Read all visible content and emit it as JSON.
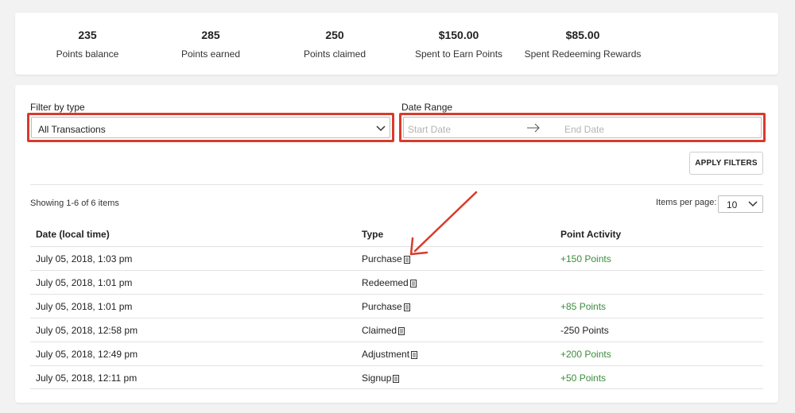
{
  "stats": [
    {
      "value": "235",
      "label": "Points balance"
    },
    {
      "value": "285",
      "label": "Points earned"
    },
    {
      "value": "250",
      "label": "Points claimed"
    },
    {
      "value": "$150.00",
      "label": "Spent to Earn Points"
    },
    {
      "value": "$85.00",
      "label": "Spent Redeeming Rewards"
    }
  ],
  "filters": {
    "type_label": "Filter by type",
    "type_value": "All Transactions",
    "date_label": "Date Range",
    "start_placeholder": "Start Date",
    "end_placeholder": "End Date",
    "apply_label": "APPLY FILTERS"
  },
  "pagination": {
    "showing": "Showing 1-6 of 6 items",
    "items_per_page_label": "Items per page:",
    "items_per_page_value": "10"
  },
  "table": {
    "headers": [
      "Date (local time)",
      "Type",
      "Point Activity"
    ],
    "rows": [
      {
        "date": "July 05, 2018, 1:03 pm",
        "type": "Purchase",
        "points": "+150 Points"
      },
      {
        "date": "July 05, 2018, 1:01 pm",
        "type": "Redeemed",
        "points": ""
      },
      {
        "date": "July 05, 2018, 1:01 pm",
        "type": "Purchase",
        "points": "+85 Points"
      },
      {
        "date": "July 05, 2018, 12:58 pm",
        "type": "Claimed",
        "points": "-250 Points"
      },
      {
        "date": "July 05, 2018, 12:49 pm",
        "type": "Adjustment",
        "points": "+200 Points"
      },
      {
        "date": "July 05, 2018, 12:11 pm",
        "type": "Signup",
        "points": "+50 Points"
      }
    ]
  },
  "colors": {
    "highlight": "#d93a2b",
    "positive_points": "#3c8c3c",
    "annotation_arrow": "#d93a2b"
  }
}
